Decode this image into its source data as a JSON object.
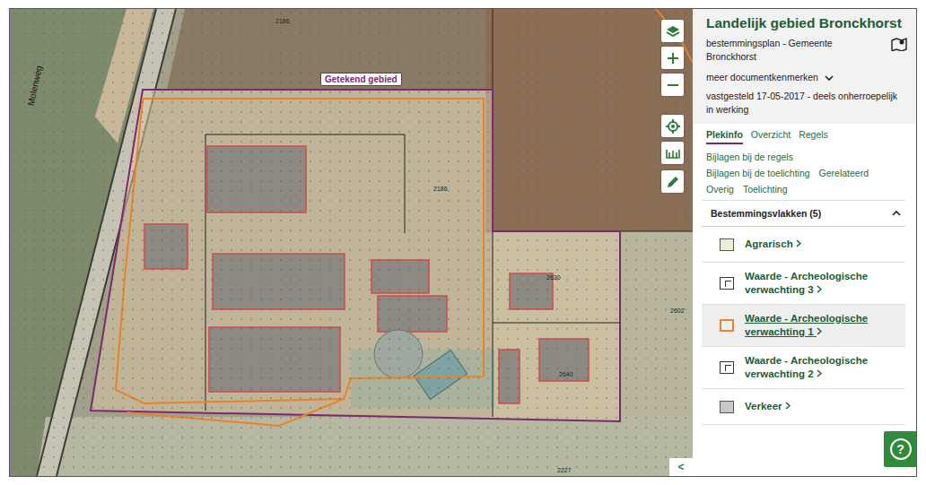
{
  "map": {
    "drawn_area_label": "Getekend gebied",
    "road_label": "Molenweg",
    "parcel_labels": [
      "2186",
      "2186",
      "2630",
      "2640",
      "2602",
      "2227"
    ],
    "collapse_button": "<"
  },
  "panel": {
    "title": "Landelijk gebied Bronckhorst",
    "subtitle": "bestemmingsplan - Gemeente Bronckhorst",
    "more_link": "meer documentkenmerken",
    "status": "vastgesteld 17-05-2017 - deels onherroepelijk in werking",
    "tabs": [
      {
        "label": "Plekinfo",
        "selected": true
      },
      {
        "label": "Overzicht",
        "selected": false
      },
      {
        "label": "Regels",
        "selected": false
      }
    ],
    "links": [
      "Bijlagen bij de regels",
      "Bijlagen bij de toelichting",
      "Gerelateerd",
      "Overig",
      "Toelichting"
    ],
    "section": {
      "title": "Bestemmingsvlakken (5)",
      "expanded": true,
      "items": [
        {
          "label": "Agrarisch",
          "kind": "fill",
          "color": "#e9f0d4",
          "selected": false
        },
        {
          "label": "Waarde - Archeologische verwachting 3",
          "kind": "pattern",
          "color": "#ffffff",
          "selected": false
        },
        {
          "label": "Waarde - Archeologische verwachting 1",
          "kind": "outline",
          "color": "#e8832a",
          "selected": true
        },
        {
          "label": "Waarde - Archeologische verwachting 2",
          "kind": "pattern",
          "color": "#ffffff",
          "selected": false
        },
        {
          "label": "Verkeer",
          "kind": "fill",
          "color": "#c8c8c8",
          "selected": false
        }
      ]
    }
  },
  "help_button": "?"
}
